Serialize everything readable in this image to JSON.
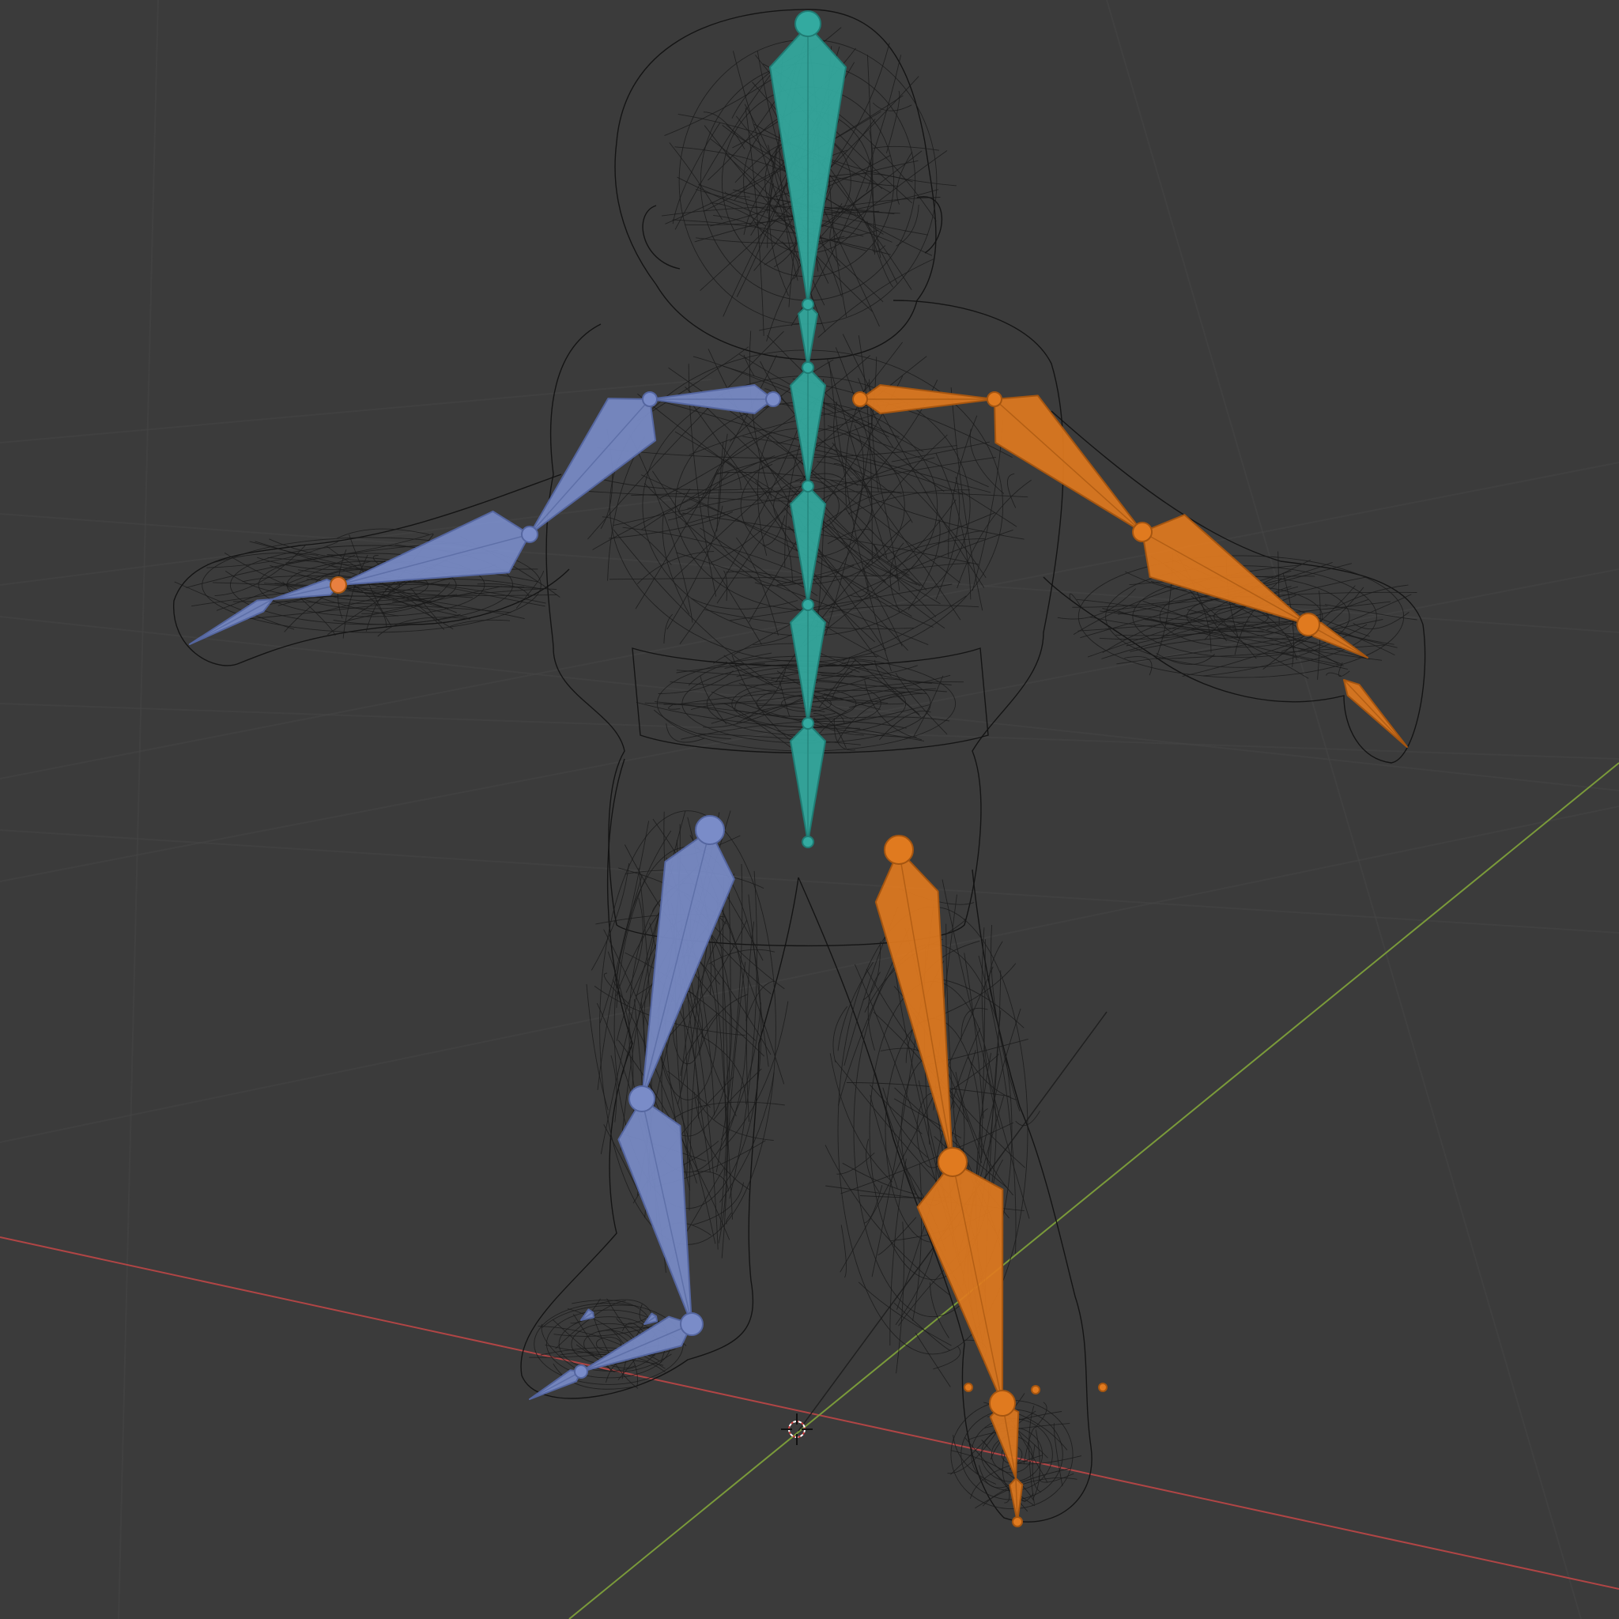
{
  "viewport": {
    "mode": "wireframe",
    "background": "#3b3b3b",
    "grid_color": "#454545",
    "axis_x_color": "#b04545",
    "axis_y_color": "#7a9a3a"
  },
  "model": {
    "mesh_color": "#111111",
    "armature": {
      "center_color": "#33aaa0",
      "center_edge": "#1f7c74",
      "left_color": "#7a8cc8",
      "left_edge": "#5566a0",
      "right_color": "#e07a1f",
      "right_edge": "#a55510"
    }
  },
  "cursor": {
    "icon": "3d-cursor-icon"
  }
}
